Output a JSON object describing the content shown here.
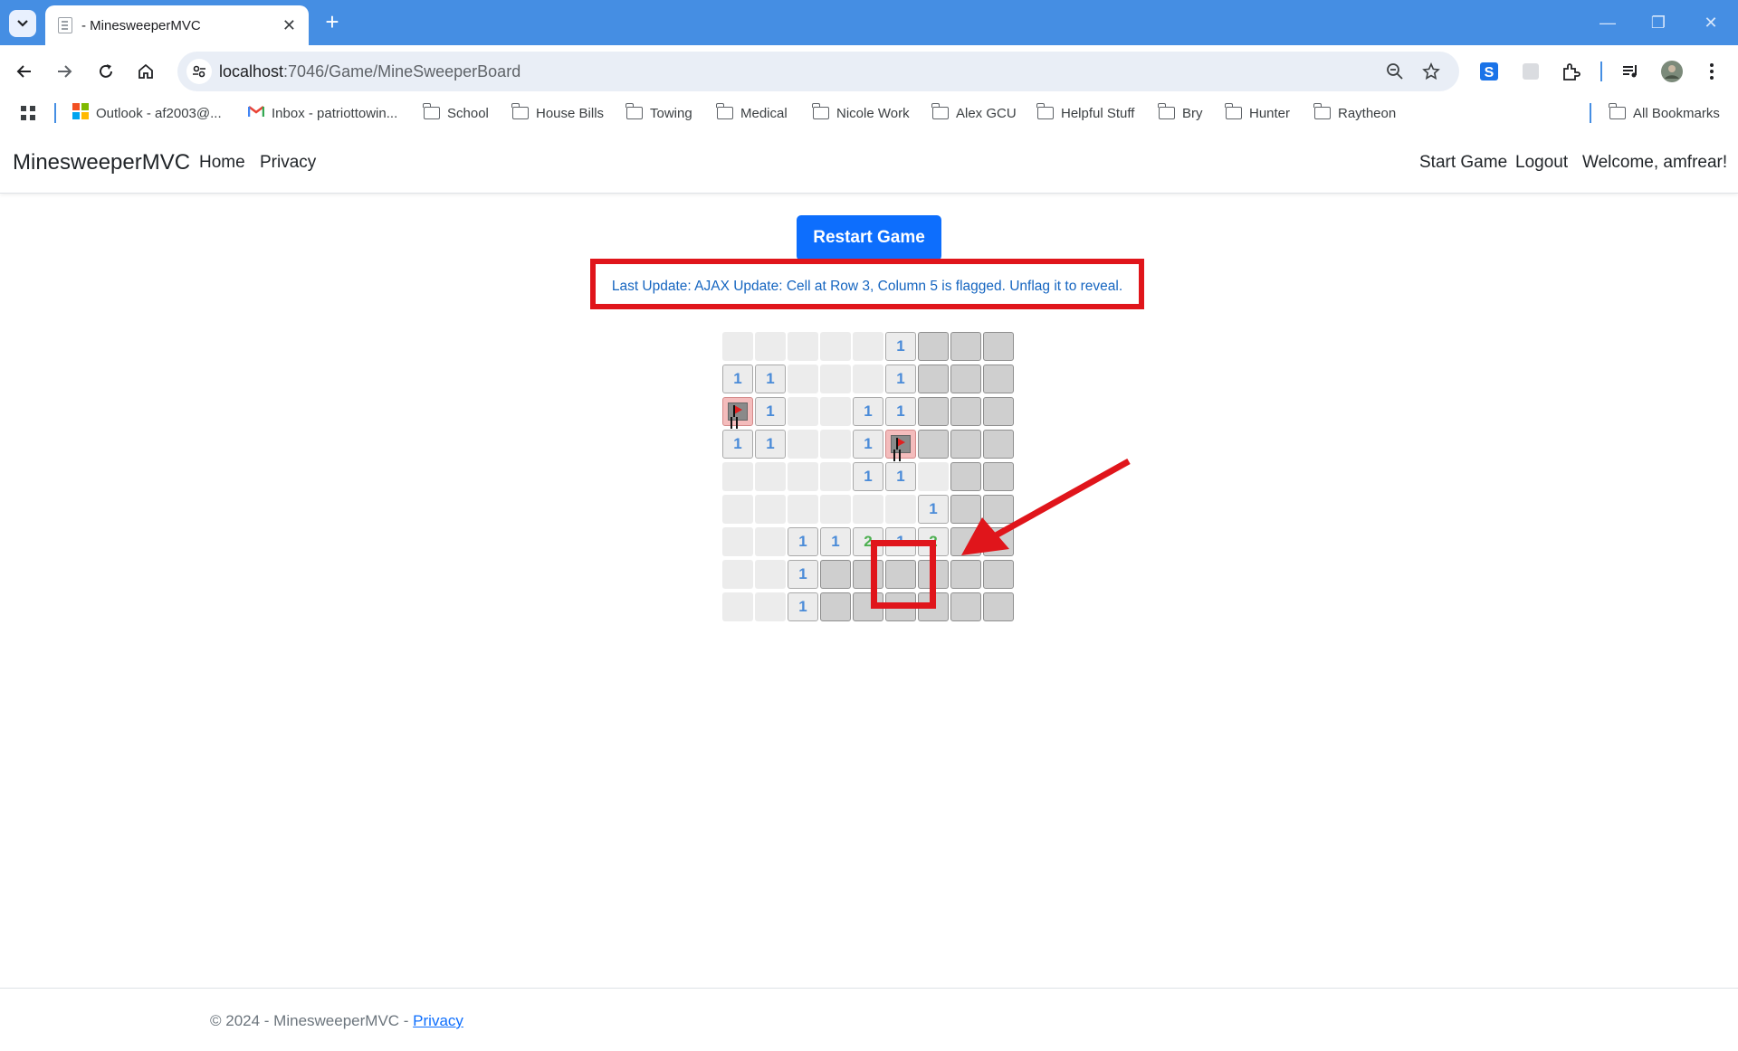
{
  "browser": {
    "tab_title": "- MinesweeperMVC",
    "url_host": "localhost",
    "url_path": ":7046/Game/MineSweeperBoard",
    "bookmarks": [
      {
        "label": "Outlook - af2003@...",
        "icon": "outlook-icon"
      },
      {
        "label": "Inbox - patriottowin...",
        "icon": "gmail-icon"
      },
      {
        "label": "School",
        "icon": "folder-icon"
      },
      {
        "label": "House Bills",
        "icon": "folder-icon"
      },
      {
        "label": "Towing",
        "icon": "folder-icon"
      },
      {
        "label": "Medical",
        "icon": "folder-icon"
      },
      {
        "label": "Nicole Work",
        "icon": "folder-icon"
      },
      {
        "label": "Alex GCU",
        "icon": "folder-icon"
      },
      {
        "label": "Helpful Stuff",
        "icon": "folder-icon"
      },
      {
        "label": "Bry",
        "icon": "folder-icon"
      },
      {
        "label": "Hunter",
        "icon": "folder-icon"
      },
      {
        "label": "Raytheon",
        "icon": "folder-icon"
      }
    ],
    "all_bookmarks": "All Bookmarks"
  },
  "nav": {
    "brand": "MinesweeperMVC",
    "home": "Home",
    "privacy": "Privacy",
    "start_game": "Start Game",
    "logout": "Logout",
    "welcome": "Welcome, amfrear!"
  },
  "game": {
    "restart_label": "Restart Game",
    "status": "Last Update: AJAX Update: Cell at Row 3, Column 5 is flagged. Unflag it to reveal.",
    "board": [
      [
        "e",
        "e",
        "e",
        "e",
        "e",
        "1",
        "h",
        "h",
        "h"
      ],
      [
        "1",
        "1",
        "e",
        "e",
        "e",
        "1",
        "h",
        "h",
        "h"
      ],
      [
        "F",
        "1",
        "e",
        "e",
        "1",
        "1",
        "h",
        "h",
        "h"
      ],
      [
        "1",
        "1",
        "e",
        "e",
        "1",
        "F",
        "h",
        "h",
        "h"
      ],
      [
        "e",
        "e",
        "e",
        "e",
        "1",
        "1",
        "e",
        "h",
        "h"
      ],
      [
        "e",
        "e",
        "e",
        "e",
        "e",
        "e",
        "1",
        "h",
        "h"
      ],
      [
        "e",
        "e",
        "1",
        "1",
        "2",
        "1",
        "2",
        "h",
        "h"
      ],
      [
        "e",
        "e",
        "1",
        "h",
        "h",
        "h",
        "h",
        "h",
        "h"
      ],
      [
        "e",
        "e",
        "1",
        "h",
        "h",
        "h",
        "h",
        "h",
        "h"
      ]
    ],
    "colors": {
      "one": "#4a8bd8",
      "two": "#4caf50",
      "highlight": "#e0151b"
    }
  },
  "footer": {
    "text": "© 2024 - MinesweeperMVC - ",
    "privacy": "Privacy"
  }
}
